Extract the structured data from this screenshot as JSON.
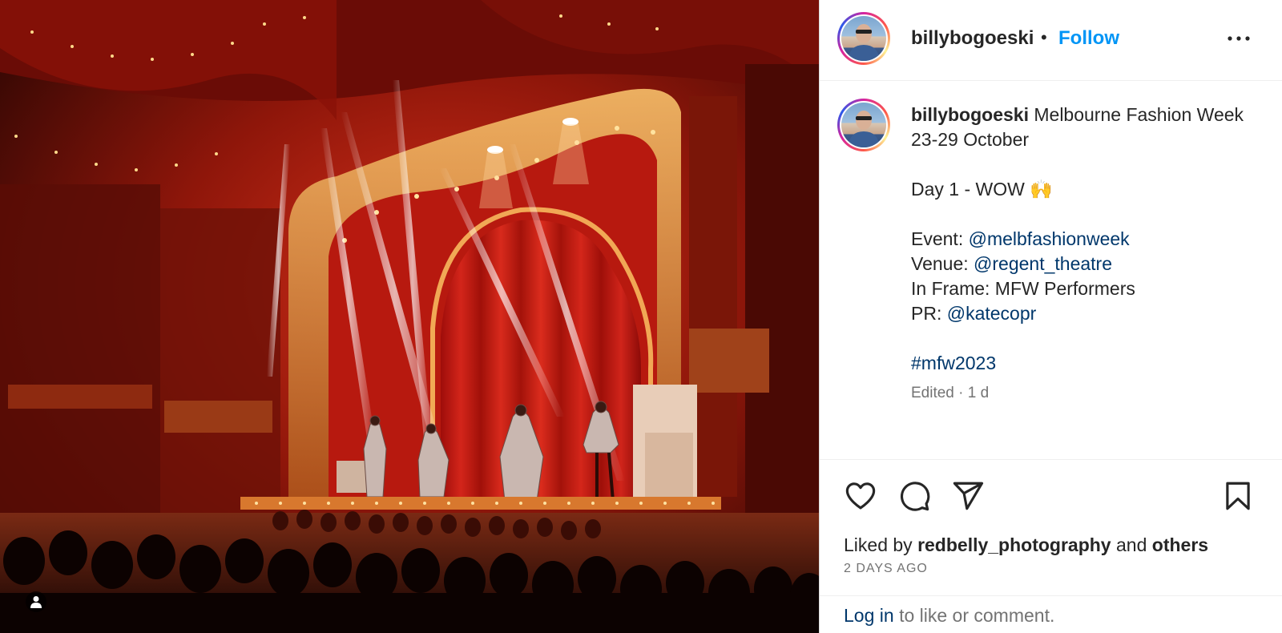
{
  "post": {
    "media_alt": "Stage with red curtains and performers",
    "colors": {
      "follow": "#0095f6",
      "link": "#00376b",
      "text": "#262626",
      "muted": "#737373"
    }
  },
  "header": {
    "username": "billybogoeski",
    "separator": "•",
    "follow_label": "Follow",
    "more_icon": "more-horizontal-icon"
  },
  "caption": {
    "username": "billybogoeski",
    "title_text": "Melbourne Fashion Week 23-29 October",
    "day_line": "Day 1 - WOW 🙌",
    "event_label": "Event:",
    "event_handle": "@melbfashionweek",
    "venue_label": "Venue:",
    "venue_handle": "@regent_theatre",
    "frame_line": "In Frame: MFW Performers",
    "pr_label": "PR:",
    "pr_handle": "@katecopr",
    "hashtag": "#mfw2023",
    "edited": "Edited · 1 d"
  },
  "actions": {
    "icons": [
      "heart-icon",
      "comment-icon",
      "share-icon",
      "bookmark-icon"
    ]
  },
  "likes": {
    "prefix": "Liked by",
    "user": "redbelly_photography",
    "conjunction": "and",
    "others": "others"
  },
  "date": "2 DAYS AGO",
  "login": {
    "link": "Log in",
    "rest": "to like or comment."
  }
}
